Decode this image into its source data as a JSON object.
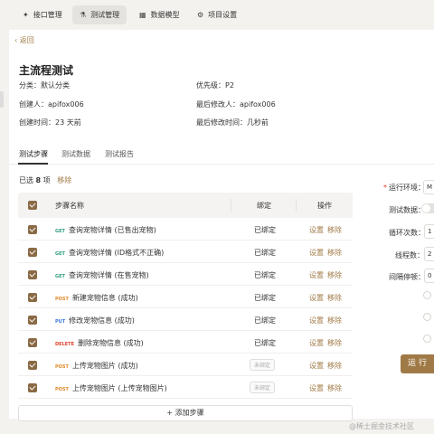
{
  "nav": {
    "tabs": [
      {
        "label": "接口管理",
        "icon": "api-icon"
      },
      {
        "label": "测试管理",
        "icon": "flask-icon",
        "active": true
      },
      {
        "label": "数据模型",
        "icon": "data-model-icon"
      },
      {
        "label": "项目设置",
        "icon": "gear-icon"
      }
    ]
  },
  "back_label": "返回",
  "title": "主流程测试",
  "meta": {
    "category": "分类：默认分类",
    "priority": "优先级：P2",
    "creator": "创建人：apifox006",
    "modifier": "最后修改人：apifox006",
    "created": "创建时间：23 天前",
    "modified": "最后修改时间：几秒前"
  },
  "subtabs": [
    "测试步骤",
    "测试数据",
    "测试报告"
  ],
  "selection": {
    "prefix": "已选",
    "count": "8",
    "suffix": "项",
    "remove": "移除"
  },
  "table": {
    "headers": [
      "步骤名称",
      "绑定",
      "操作"
    ],
    "rows": [
      {
        "method": "GET",
        "name": "查询宠物详情 (已售出宠物)",
        "binding": "已绑定",
        "bound": true
      },
      {
        "method": "GET",
        "name": "查询宠物详情 (ID格式不正确)",
        "binding": "已绑定",
        "bound": true
      },
      {
        "method": "GET",
        "name": "查询宠物详情 (在售宠物)",
        "binding": "已绑定",
        "bound": true
      },
      {
        "method": "POST",
        "name": "新建宠物信息 (成功)",
        "binding": "已绑定",
        "bound": true
      },
      {
        "method": "PUT",
        "name": "修改宠物信息 (成功)",
        "binding": "已绑定",
        "bound": true
      },
      {
        "method": "DELETE",
        "name": "删除宠物信息 (成功)",
        "binding": "已绑定",
        "bound": true
      },
      {
        "method": "POST",
        "name": "上传宠物图片 (成功)",
        "binding": "未绑定",
        "bound": false
      },
      {
        "method": "POST",
        "name": "上传宠物图片 (上传宠物图片)",
        "binding": "未绑定",
        "bound": false
      }
    ],
    "op_settings": "设置",
    "op_remove": "移除"
  },
  "add_step": "添加步骤",
  "run_panel": {
    "env_label": "运行环境：",
    "env_value": "M",
    "data_label": "测试数据：",
    "loops_label": "循环次数：",
    "loops_value": "1",
    "threads_label": "线程数：",
    "threads_value": "2",
    "interval_label": "间隔停顿：",
    "interval_value": "0",
    "run_button": "运行"
  },
  "watermark": "@稀土掘金技术社区",
  "colors": {
    "accent": "#a07a46",
    "get": "#2e9c7c",
    "post": "#e08a2c",
    "put": "#3d7be0",
    "delete": "#e0422c"
  }
}
